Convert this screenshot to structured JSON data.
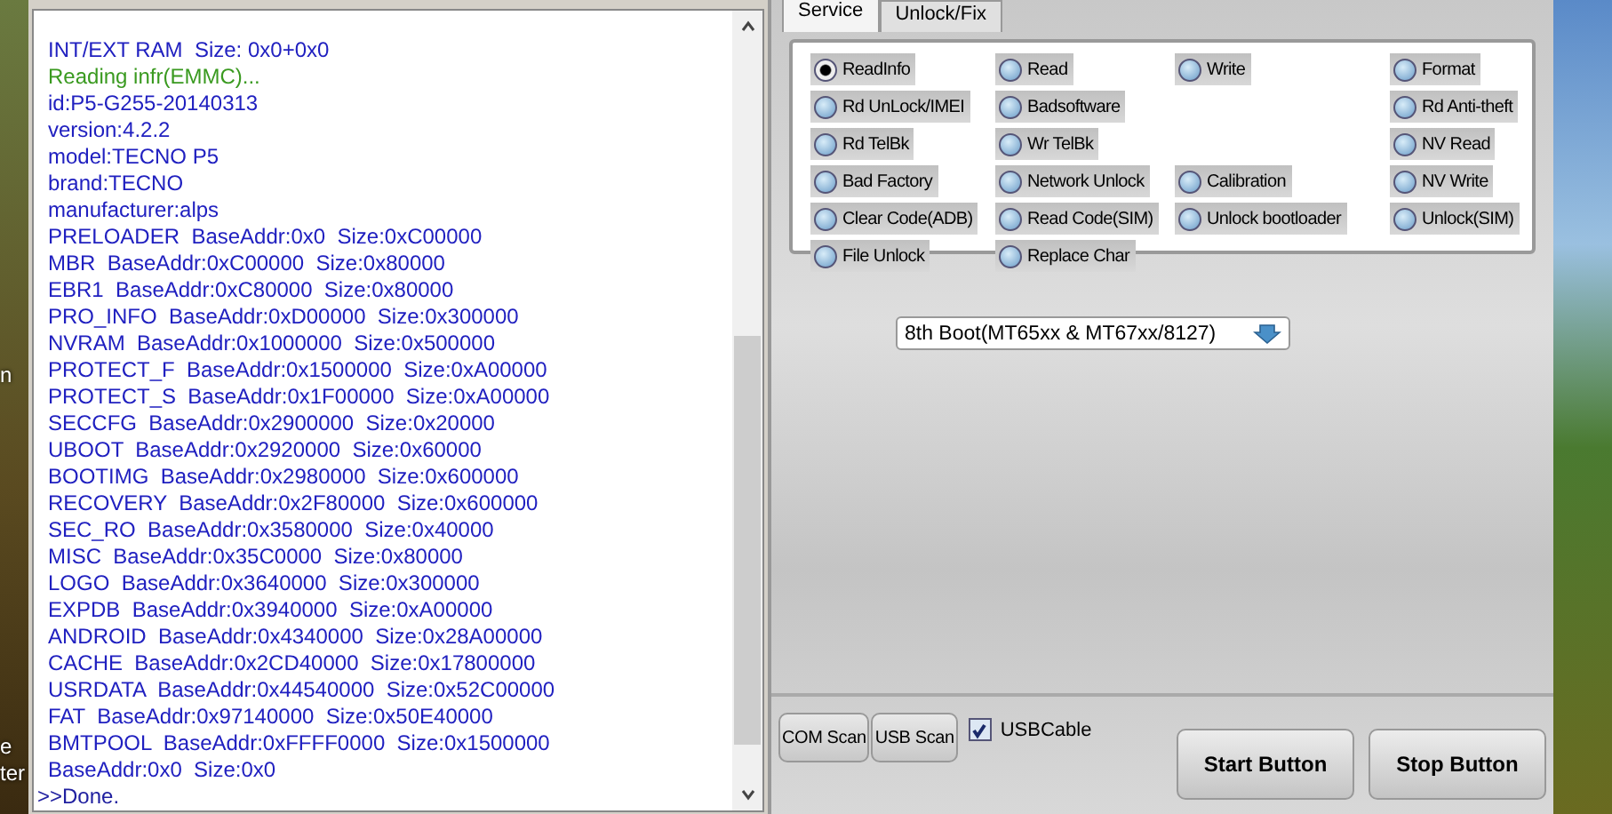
{
  "desktop_labels": [
    "n",
    "e",
    "ter"
  ],
  "log": {
    "lines": [
      {
        "kind": "entry",
        "text": "INT/EXT RAM  Size: 0x0+0x0"
      },
      {
        "kind": "status",
        "text": "Reading infr(EMMC)..."
      },
      {
        "kind": "entry",
        "text": "id:P5-G255-20140313"
      },
      {
        "kind": "entry",
        "text": "version:4.2.2"
      },
      {
        "kind": "entry",
        "text": "model:TECNO P5"
      },
      {
        "kind": "entry",
        "text": "brand:TECNO"
      },
      {
        "kind": "entry",
        "text": "manufacturer:alps"
      },
      {
        "kind": "entry",
        "text": "PRELOADER  BaseAddr:0x0  Size:0xC00000"
      },
      {
        "kind": "entry",
        "text": "MBR  BaseAddr:0xC00000  Size:0x80000"
      },
      {
        "kind": "entry",
        "text": "EBR1  BaseAddr:0xC80000  Size:0x80000"
      },
      {
        "kind": "entry",
        "text": "PRO_INFO  BaseAddr:0xD00000  Size:0x300000"
      },
      {
        "kind": "entry",
        "text": "NVRAM  BaseAddr:0x1000000  Size:0x500000"
      },
      {
        "kind": "entry",
        "text": "PROTECT_F  BaseAddr:0x1500000  Size:0xA00000"
      },
      {
        "kind": "entry",
        "text": "PROTECT_S  BaseAddr:0x1F00000  Size:0xA00000"
      },
      {
        "kind": "entry",
        "text": "SECCFG  BaseAddr:0x2900000  Size:0x20000"
      },
      {
        "kind": "entry",
        "text": "UBOOT  BaseAddr:0x2920000  Size:0x60000"
      },
      {
        "kind": "entry",
        "text": "BOOTIMG  BaseAddr:0x2980000  Size:0x600000"
      },
      {
        "kind": "entry",
        "text": "RECOVERY  BaseAddr:0x2F80000  Size:0x600000"
      },
      {
        "kind": "entry",
        "text": "SEC_RO  BaseAddr:0x3580000  Size:0x40000"
      },
      {
        "kind": "entry",
        "text": "MISC  BaseAddr:0x35C0000  Size:0x80000"
      },
      {
        "kind": "entry",
        "text": "LOGO  BaseAddr:0x3640000  Size:0x300000"
      },
      {
        "kind": "entry",
        "text": "EXPDB  BaseAddr:0x3940000  Size:0xA00000"
      },
      {
        "kind": "entry",
        "text": "ANDROID  BaseAddr:0x4340000  Size:0x28A00000"
      },
      {
        "kind": "entry",
        "text": "CACHE  BaseAddr:0x2CD40000  Size:0x17800000"
      },
      {
        "kind": "entry",
        "text": "USRDATA  BaseAddr:0x44540000  Size:0x52C00000"
      },
      {
        "kind": "entry",
        "text": "FAT  BaseAddr:0x97140000  Size:0x50E40000"
      },
      {
        "kind": "entry",
        "text": "BMTPOOL  BaseAddr:0xFFFF0000  Size:0x1500000"
      },
      {
        "kind": "entry",
        "text": "BaseAddr:0x0  Size:0x0"
      },
      {
        "kind": "result",
        "text": ">>Done."
      }
    ]
  },
  "tabs": [
    {
      "label": "Service",
      "selected": true
    },
    {
      "label": "Unlock/Fix",
      "selected": false
    }
  ],
  "options": {
    "rows": [
      [
        {
          "label": "ReadInfo",
          "selected": true
        },
        {
          "label": "Read",
          "selected": false
        },
        {
          "label": "Write",
          "selected": false
        },
        {
          "label": "Format",
          "selected": false
        }
      ],
      [
        {
          "label": "Rd UnLock/IMEI",
          "selected": false
        },
        {
          "label": "Badsoftware",
          "selected": false
        },
        null,
        {
          "label": "Rd Anti-theft",
          "selected": false
        }
      ],
      [
        {
          "label": "Rd TelBk",
          "selected": false
        },
        {
          "label": "Wr TelBk",
          "selected": false
        },
        null,
        {
          "label": "NV Read",
          "selected": false
        }
      ],
      [
        {
          "label": "Bad Factory",
          "selected": false
        },
        {
          "label": "Network Unlock",
          "selected": false
        },
        {
          "label": "Calibration",
          "selected": false
        },
        {
          "label": "NV Write",
          "selected": false
        }
      ],
      [
        {
          "label": "Clear Code(ADB)",
          "selected": false
        },
        {
          "label": "Read Code(SIM)",
          "selected": false
        },
        {
          "label": "Unlock bootloader",
          "selected": false
        },
        {
          "label": "Unlock(SIM)",
          "selected": false
        }
      ],
      [
        {
          "label": "File Unlock",
          "selected": false
        },
        {
          "label": "Replace Char",
          "selected": false
        },
        null,
        null
      ]
    ]
  },
  "boot_select": {
    "value": "8th Boot(MT65xx & MT67xx/8127)"
  },
  "scan_buttons": [
    "COM Scan",
    "USB Scan"
  ],
  "usb_cable": {
    "label": "USBCable",
    "checked": true
  },
  "action_buttons": [
    "Start Button",
    "Stop Button"
  ]
}
